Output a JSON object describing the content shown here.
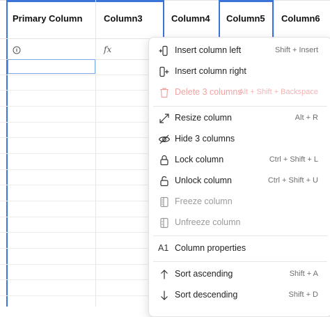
{
  "columns": [
    {
      "label": "Primary Column"
    },
    {
      "label": "Column3"
    },
    {
      "label": "Column4"
    },
    {
      "label": "Column5"
    },
    {
      "label": "Column6"
    }
  ],
  "type_icons": {
    "info": "info-circle-icon",
    "formula": "fx",
    "formula_icon": "function-icon"
  },
  "colors": {
    "selection": "#3b74d9",
    "danger_disabled": "#f0a3a3"
  },
  "menu": {
    "insert_left": {
      "label": "Insert column left",
      "shortcut": "Shift + Insert",
      "icon": "insert-left-icon"
    },
    "insert_right": {
      "label": "Insert column right",
      "shortcut": "",
      "icon": "insert-right-icon"
    },
    "delete": {
      "label": "Delete 3 columns",
      "shortcut": "Alt + Shift + Backspace",
      "icon": "trash-icon"
    },
    "resize": {
      "label": "Resize column",
      "shortcut": "Alt + R",
      "icon": "resize-icon"
    },
    "hide": {
      "label": "Hide 3 columns",
      "shortcut": "",
      "icon": "eye-off-icon"
    },
    "lock": {
      "label": "Lock column",
      "shortcut": "Ctrl + Shift + L",
      "icon": "lock-icon"
    },
    "unlock": {
      "label": "Unlock column",
      "shortcut": "Ctrl + Shift + U",
      "icon": "unlock-icon"
    },
    "freeze": {
      "label": "Freeze column",
      "shortcut": "",
      "icon": "freeze-icon"
    },
    "unfreeze": {
      "label": "Unfreeze column",
      "shortcut": "",
      "icon": "unfreeze-icon"
    },
    "properties": {
      "label": "Column properties",
      "shortcut": "",
      "icon_text": "A1",
      "icon": "column-properties-icon"
    },
    "sort_asc": {
      "label": "Sort ascending",
      "shortcut": "Shift + A",
      "icon": "arrow-up-icon"
    },
    "sort_desc": {
      "label": "Sort descending",
      "shortcut": "Shift + D",
      "icon": "arrow-down-icon"
    }
  }
}
